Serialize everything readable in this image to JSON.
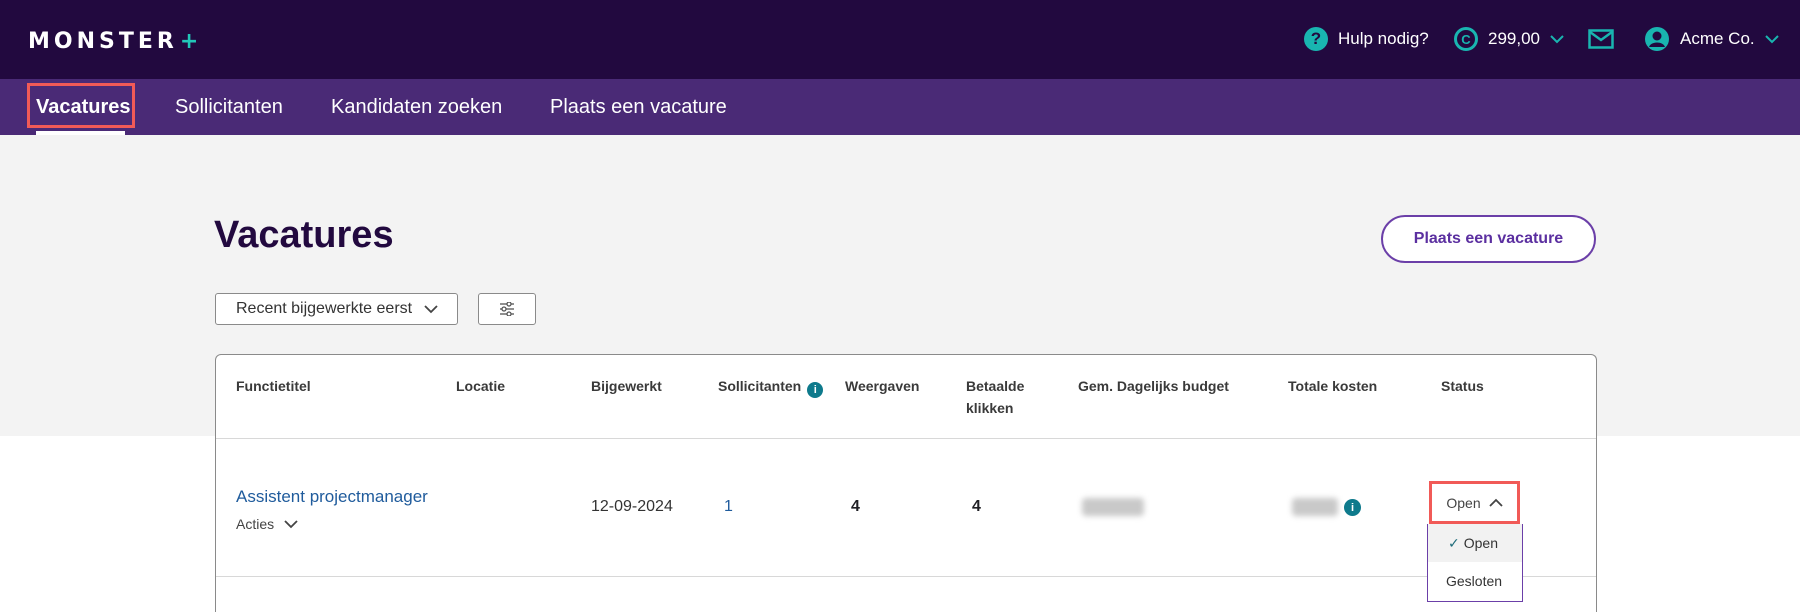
{
  "header": {
    "logo_text": "MONSTER",
    "logo_plus": "+",
    "help_label": "Hulp nodig?",
    "help_icon_glyph": "?",
    "credits_value": "299,00",
    "credit_icon_glyph": "C",
    "account_name": "Acme Co."
  },
  "nav": {
    "items": [
      {
        "label": "Vacatures",
        "active": true
      },
      {
        "label": "Sollicitanten"
      },
      {
        "label": "Kandidaten zoeken"
      },
      {
        "label": "Plaats een vacature"
      }
    ]
  },
  "page": {
    "title": "Vacatures",
    "post_button": "Plaats een vacature",
    "sort_label": "Recent bijgewerkte eerst"
  },
  "table": {
    "columns": [
      "Functietitel",
      "Locatie",
      "Bijgewerkt",
      "Sollicitanten",
      "Weergaven",
      "Betaalde klikken",
      "Gem. Dagelijks budget",
      "Totale kosten",
      "Status"
    ],
    "info_glyph": "i",
    "rows": [
      {
        "title": "Assistent projectmanager",
        "actions_label": "Acties",
        "location": "",
        "updated": "12-09-2024",
        "applicants": "1",
        "views": "4",
        "paid_clicks": "4",
        "status": "Open"
      }
    ]
  },
  "status_menu": {
    "options": [
      "Open",
      "Gesloten"
    ],
    "selected": "Open",
    "check_glyph": "✓"
  },
  "colors": {
    "topbar": "#22093f",
    "navbar": "#4a2a76",
    "accent_teal": "#19b5b0",
    "highlight": "#f15a57",
    "link": "#1f5b9c"
  }
}
